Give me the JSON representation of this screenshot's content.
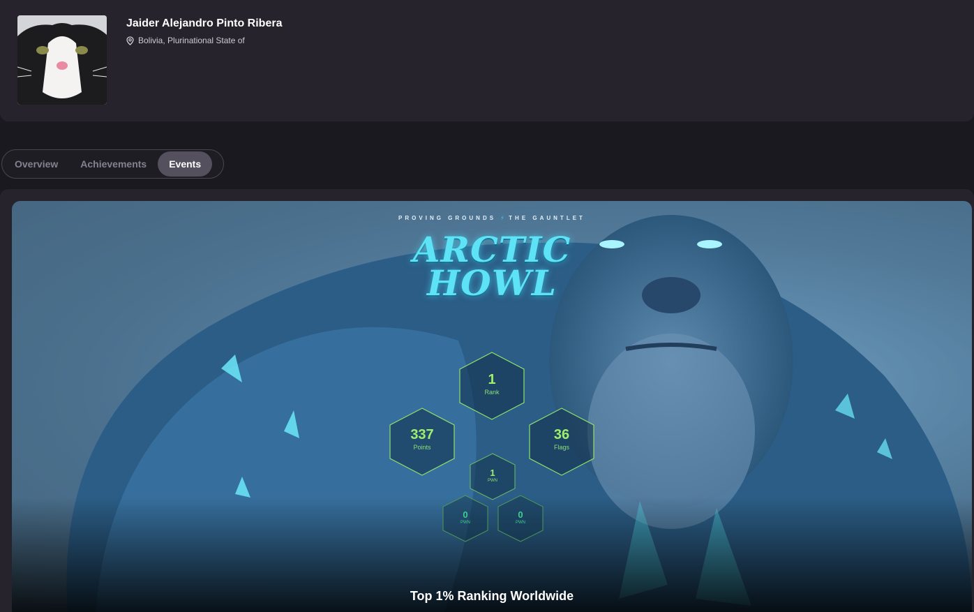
{
  "profile": {
    "name": "Jaider Alejandro Pinto Ribera",
    "location": "Bolivia, Plurinational State of"
  },
  "tabs": [
    {
      "label": "Overview",
      "active": false
    },
    {
      "label": "Achievements",
      "active": false
    },
    {
      "label": "Events",
      "active": true
    }
  ],
  "event": {
    "subtitle_left": "PROVING GROUNDS",
    "subtitle_right": "THE GAUNTLET",
    "title_line1": "ARCTIC",
    "title_line2": "HOWL",
    "stats": {
      "rank": {
        "value": "1",
        "label": "Rank"
      },
      "points": {
        "value": "337",
        "label": "Points"
      },
      "flags": {
        "value": "36",
        "label": "Flags"
      },
      "pwn_top": {
        "value": "1",
        "label": "PWN"
      },
      "pwn_left": {
        "value": "0",
        "label": "PWN"
      },
      "pwn_right": {
        "value": "0",
        "label": "PWN"
      }
    },
    "ranking_text": "Top 1% Ranking Worldwide"
  },
  "colors": {
    "page_bg": "#1b1920",
    "card_bg": "#26232c",
    "tab_active_bg": "#55505d",
    "accent_ice": "#5de3f5",
    "stat_green": "#9ef06c"
  }
}
